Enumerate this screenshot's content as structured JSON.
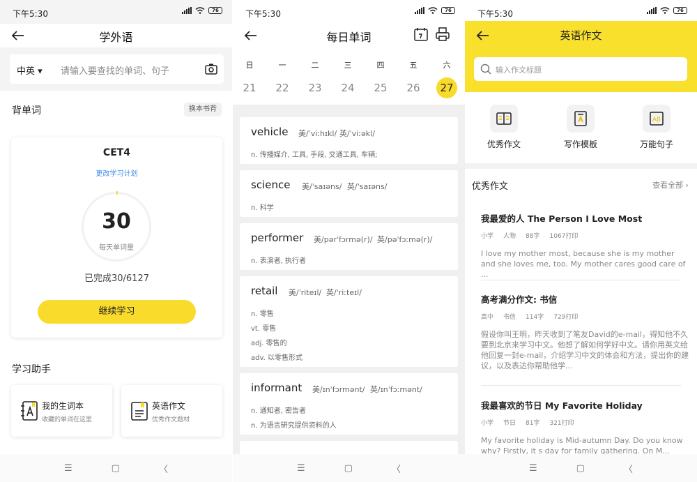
{
  "status": {
    "time": "下午5:30",
    "battery": "76"
  },
  "screen1": {
    "title": "学外语",
    "search": {
      "lang": "中英 ▾",
      "placeholder": "请输入要查找的单词、句子"
    },
    "section_words": "背单词",
    "change_book": "换本书背",
    "book": "CET4",
    "plan_link": "更改学习计划",
    "daily_count": "30",
    "daily_caption": "每天单词量",
    "progress_text": "已完成30/6127",
    "continue_button": "继续学习",
    "section_helper": "学习助手",
    "helpers": [
      {
        "title": "我的生词本",
        "subtitle": "收藏的单词在这里"
      },
      {
        "title": "英语作文",
        "subtitle": "优秀作文题材"
      }
    ]
  },
  "screen2": {
    "title": "每日单词",
    "weekdays": [
      "日",
      "一",
      "二",
      "三",
      "四",
      "五",
      "六"
    ],
    "dates": [
      "21",
      "22",
      "23",
      "24",
      "25",
      "26",
      "27"
    ],
    "selected_date": "27",
    "words": [
      {
        "word": "vehicle",
        "us": "美/ˈviːhɪkl/",
        "uk": "英/ˈviːəkl/",
        "meanings": [
          "n. 传播媒介, 工具, 手段, 交通工具, 车辆;"
        ]
      },
      {
        "word": "science",
        "us": "美/ˈsaɪəns/",
        "uk": "英/ˈsaɪəns/",
        "meanings": [
          "n. 科学"
        ]
      },
      {
        "word": "performer",
        "us": "美/pərˈfɔrmə(r)/",
        "uk": "英/pəˈfɔːmə(r)/",
        "meanings": [
          "n. 表演者, 执行者"
        ]
      },
      {
        "word": "retail",
        "us": "美/ˈriteɪl/",
        "uk": "英/ˈriːteɪl/",
        "meanings": [
          "n. 零售",
          "vt. 零售",
          "adj. 零售的",
          "adv. 以零售形式"
        ]
      },
      {
        "word": "informant",
        "us": "美/ɪnˈfɔrmənt/",
        "uk": "英/ɪnˈfɔːmənt/",
        "meanings": [
          "n. 通知者, 密告者",
          "n. 为语言研究提供资料的人"
        ]
      }
    ]
  },
  "screen3": {
    "title": "英语作文",
    "search_placeholder": "输入作文标题",
    "categories": [
      {
        "label": "优秀作文",
        "icon": "book-open-icon"
      },
      {
        "label": "写作模板",
        "icon": "template-icon"
      },
      {
        "label": "万能句子",
        "icon": "ab-sentence-icon"
      }
    ],
    "section": "优秀作文",
    "view_all": "查看全部",
    "articles": [
      {
        "title": "我最爱的人 The Person I Love Most",
        "level": "小学",
        "tag": "人物",
        "words": "88字",
        "prints": "1067打印",
        "excerpt": "I love my mother most, because she is my mother and she loves me, too. My mother cares good care of ..."
      },
      {
        "title": "高考满分作文: 书信",
        "level": "高中",
        "tag": "书信",
        "words": "114字",
        "prints": "729打印",
        "excerpt": "假设你叫王明，昨天收到了笔友David的e-mail，得知他不久要到北京来学习中文。他想了解如何学好中文。请你用英文给他回复一封e-mail，介绍学习中文的体会和方法，提出你的建议，以及表达你帮助他学..."
      },
      {
        "title": "我最喜欢的节日 My Favorite Holiday",
        "level": "小学",
        "tag": "节日",
        "words": "81字",
        "prints": "321打印",
        "excerpt": "My favorite holiday is Mid-autumn Day. Do you know why? Firstly, it s day for family gathering. On M..."
      }
    ]
  },
  "sysnav": {
    "menu": "☰",
    "home": "▢",
    "back": "〈"
  },
  "colors": {
    "accent": "#f9db2b",
    "link": "#3d8be6"
  }
}
